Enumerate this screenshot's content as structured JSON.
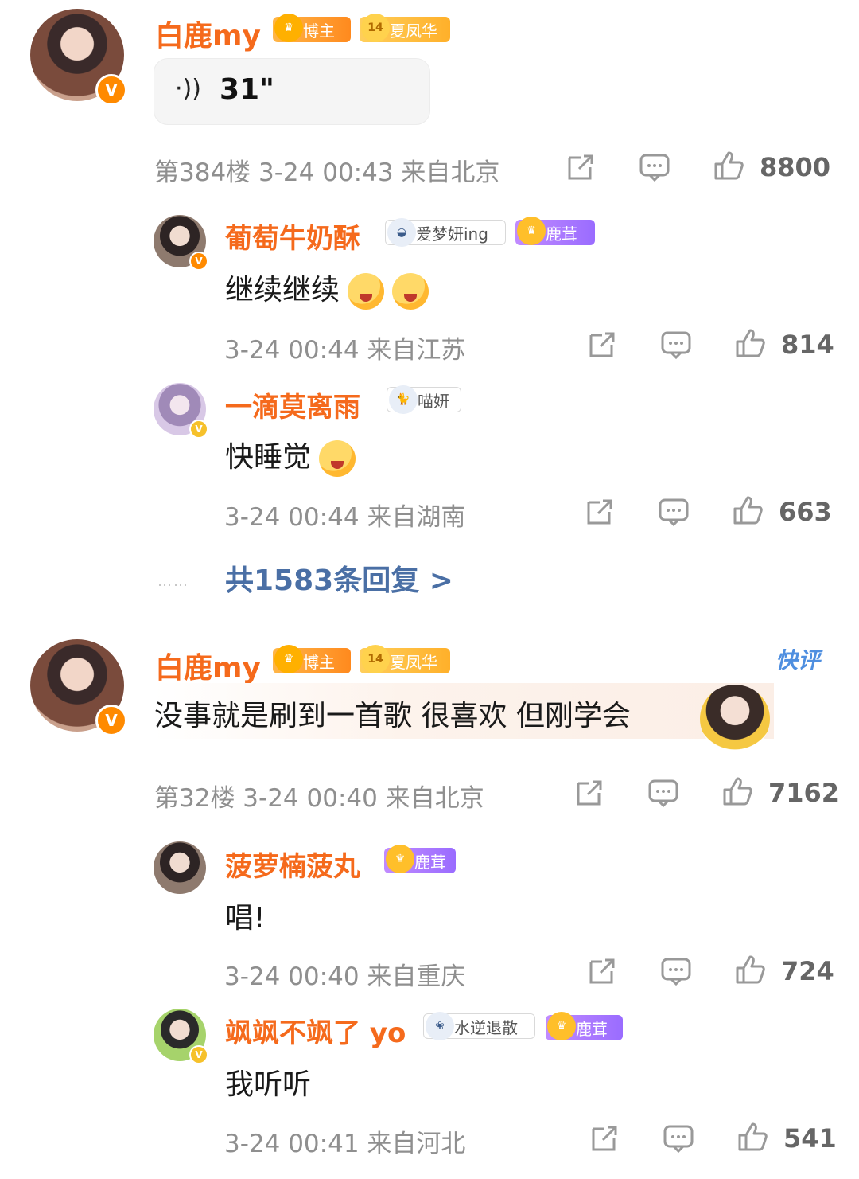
{
  "comments": [
    {
      "user": "白鹿my",
      "badges": [
        "博主",
        "夏凤华"
      ],
      "badge_level": "14",
      "voice_duration": "31\"",
      "meta": "第384楼 3-24 00:43 来自北京",
      "likes": "8800",
      "replies": [
        {
          "user": "葡萄牛奶酥",
          "badges": [
            "爱梦妍ing",
            "鹿茸"
          ],
          "text": "继续继续",
          "meta": "3-24 00:44 来自江苏",
          "likes": "814"
        },
        {
          "user": "一滴莫离雨",
          "badges": [
            "喵妍"
          ],
          "text": "快睡觉",
          "meta": "3-24 00:44 来自湖南",
          "likes": "663"
        }
      ],
      "more_replies": "共1583条回复 >"
    },
    {
      "user": "白鹿my",
      "badges": [
        "博主",
        "夏凤华"
      ],
      "badge_level": "14",
      "tag": "快评",
      "text": "没事就是刷到一首歌 很喜欢 但刚学会",
      "meta": "第32楼 3-24 00:40 来自北京",
      "likes": "7162",
      "replies": [
        {
          "user": "菠萝楠菠丸",
          "badges": [
            "鹿茸"
          ],
          "text": "唱!",
          "meta": "3-24 00:40 来自重庆",
          "likes": "724"
        },
        {
          "user": "飒飒不飒了 yo",
          "badges": [
            "水逆退散",
            "鹿茸"
          ],
          "text": "我听听",
          "meta": "3-24 00:41 来自河北",
          "likes": "541"
        }
      ]
    }
  ],
  "colors": {
    "name": "#f56a1c",
    "meta": "#8f8f8f",
    "link": "#4a6fa5"
  }
}
